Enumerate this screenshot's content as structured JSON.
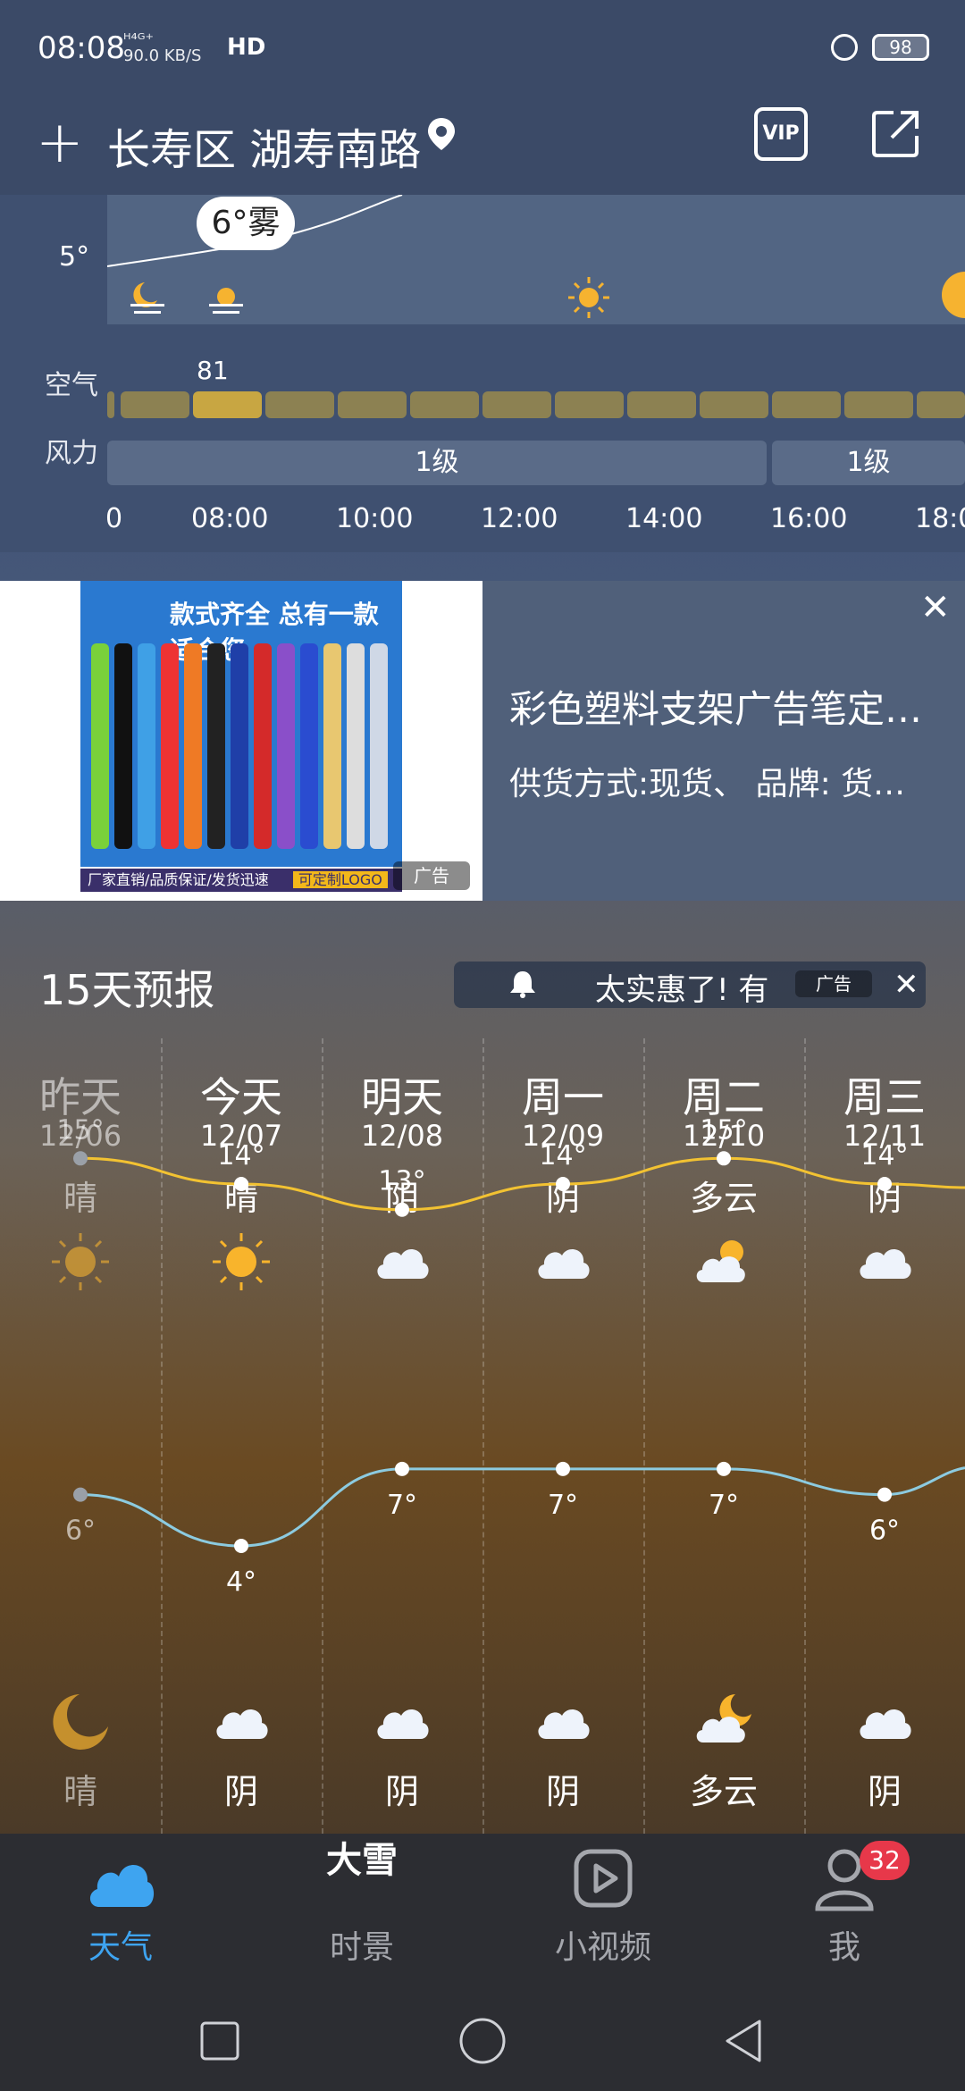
{
  "status_bar": {
    "time": "08:08",
    "net_line1": "ᴴ⁴ᴳ⁺",
    "net_line2": "90.0 KB/S",
    "hd": "HD",
    "battery": "98"
  },
  "header": {
    "location": "长寿区 湖寿南路"
  },
  "hourly": {
    "current_temp": "5°",
    "current_weather": "6°雾",
    "air_label": "空气",
    "air_value": "81",
    "wind_label": "风力",
    "wind_levels": [
      "1级",
      "1级"
    ],
    "hour_ticks": [
      "0",
      "08:00",
      "10:00",
      "12:00",
      "14:00",
      "16:00",
      "18:0"
    ]
  },
  "ad": {
    "banner_text": "款式齐全 总有一款适合您",
    "strip_left": "厂家直销/品质保证/发货迅速",
    "strip_right": "可定制LOGO",
    "tag": "广告",
    "title": "彩色塑料支架广告笔定…",
    "desc": "供货方式:现货、 品牌: 货…",
    "close": "✕"
  },
  "forecast": {
    "title": "15天预报",
    "promo_text": "太实惠了! 有",
    "promo_tag": "广告",
    "promo_close": "✕",
    "days": [
      {
        "name": "昨天",
        "date": "12/06",
        "day_cond": "晴",
        "day_icon": "sun-icon",
        "high": "15°",
        "low": "6°",
        "night_cond": "晴",
        "night_icon": "moon-icon"
      },
      {
        "name": "今天",
        "date": "12/07",
        "day_cond": "晴",
        "day_icon": "sun-icon",
        "high": "14°",
        "low": "4°",
        "night_cond": "阴",
        "night_icon": "cloud-icon"
      },
      {
        "name": "明天",
        "date": "12/08",
        "day_cond": "阴",
        "day_icon": "cloud-icon",
        "high": "13°",
        "low": "7°",
        "night_cond": "阴",
        "night_icon": "cloud-icon"
      },
      {
        "name": "周一",
        "date": "12/09",
        "day_cond": "阴",
        "day_icon": "cloud-icon",
        "high": "14°",
        "low": "7°",
        "night_cond": "阴",
        "night_icon": "cloud-icon"
      },
      {
        "name": "周二",
        "date": "12/10",
        "day_cond": "多云",
        "day_icon": "partly-cloudy-icon",
        "high": "15°",
        "low": "7°",
        "night_cond": "多云",
        "night_icon": "partly-cloudy-night-icon"
      },
      {
        "name": "周三",
        "date": "12/11",
        "day_cond": "阴",
        "day_icon": "cloud-icon",
        "high": "14°",
        "low": "6°",
        "night_cond": "阴",
        "night_icon": "cloud-icon"
      }
    ]
  },
  "chart_data": {
    "type": "line",
    "categories": [
      "12/06",
      "12/07",
      "12/08",
      "12/09",
      "12/10",
      "12/11"
    ],
    "series": [
      {
        "values": [
          15,
          14,
          13,
          14,
          15,
          14
        ],
        "color": "#f2c232"
      },
      {
        "values": [
          6,
          4,
          7,
          7,
          7,
          6
        ],
        "color": "#8ccbe0"
      }
    ]
  },
  "tabs": [
    {
      "label": "天气",
      "icon": "cloud-icon",
      "active": true
    },
    {
      "label": "时景",
      "icon": "snow-scene-icon",
      "icon_text": "大雪"
    },
    {
      "label": "小视频",
      "icon": "play-icon"
    },
    {
      "label": "我",
      "icon": "user-icon",
      "badge": "32"
    }
  ],
  "colors": {
    "accent": "#3ea4f0",
    "tab_inactive": "#a5a7ad",
    "high_line": "#f2c232",
    "low_line": "#8ccbe0"
  }
}
